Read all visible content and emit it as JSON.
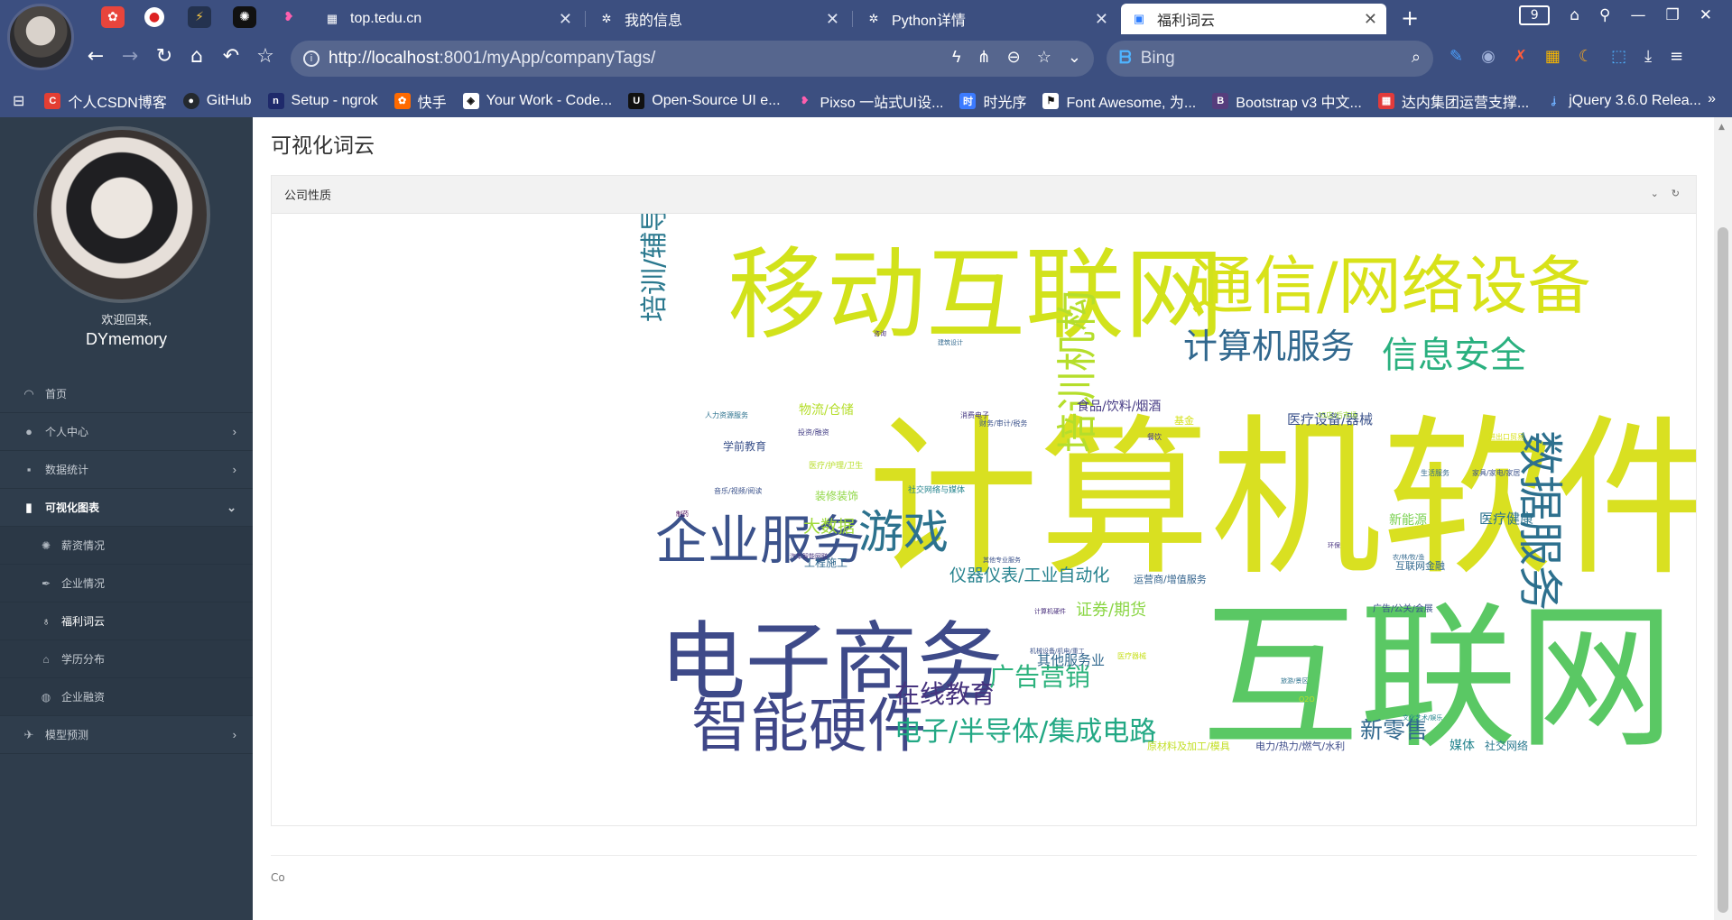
{
  "browser": {
    "tabs": [
      {
        "title": "top.tedu.cn"
      },
      {
        "title": "我的信息"
      },
      {
        "title": "Python详情"
      },
      {
        "title": "福利词云"
      }
    ],
    "tab_count": "9",
    "url_host": "http://localhost",
    "url_rest": ":8001/myApp/companyTags/",
    "search_placeholder": "Bing",
    "bookmarks": [
      {
        "label": "个人CSDN博客",
        "icon": "csdn-icon",
        "color": "#e33e33"
      },
      {
        "label": "GitHub",
        "icon": "github-icon",
        "color": "#24292e"
      },
      {
        "label": "Setup - ngrok",
        "icon": "ngrok-icon",
        "color": "#1f2a6b"
      },
      {
        "label": "快手",
        "icon": "kuaishou-icon",
        "color": "#ff6a00"
      },
      {
        "label": "Your Work - Code...",
        "icon": "codepen-icon",
        "color": "#111111"
      },
      {
        "label": "Open-Source UI e...",
        "icon": "ui-icon",
        "color": "#111111"
      },
      {
        "label": "Pixso 一站式UI设...",
        "icon": "pixso-icon",
        "color": "#ff4fa3"
      },
      {
        "label": "时光序",
        "icon": "shiguangxu-icon",
        "color": "#3c7bff"
      },
      {
        "label": "Font Awesome, 为...",
        "icon": "flag-icon",
        "color": "#111111"
      },
      {
        "label": "Bootstrap v3 中文...",
        "icon": "bootstrap-icon",
        "color": "#563d7c"
      },
      {
        "label": "达内集团运营支撑...",
        "icon": "tedu-icon",
        "color": "#e23b3b"
      },
      {
        "label": "jQuery 3.6.0 Relea...",
        "icon": "jquery-icon",
        "color": "#2f6ac0"
      }
    ]
  },
  "sidebar": {
    "welcome": "欢迎回来,",
    "username": "DYmemory",
    "menu": [
      {
        "label": "首页",
        "icon": "dashboard-icon"
      },
      {
        "label": "个人中心",
        "icon": "user-icon"
      },
      {
        "label": "数据统计",
        "icon": "grid-icon"
      },
      {
        "label": "可视化图表",
        "icon": "bar-chart-icon"
      },
      {
        "label": "模型预测",
        "icon": "plane-icon"
      }
    ],
    "submenu": [
      {
        "label": "薪资情况",
        "icon": "sun-icon"
      },
      {
        "label": "企业情况",
        "icon": "feather-icon"
      },
      {
        "label": "福利词云",
        "icon": "lightbulb-icon"
      },
      {
        "label": "学历分布",
        "icon": "graduation-cap-icon"
      },
      {
        "label": "企业融资",
        "icon": "globe-icon"
      }
    ]
  },
  "main": {
    "page_title": "可视化词云",
    "panel_title": "公司性质",
    "footer_text": "Co"
  },
  "wordcloud": {
    "words": [
      {
        "text": "计算机软件",
        "color": "#d9e021"
      },
      {
        "text": "互联网",
        "color": "#5ac864"
      },
      {
        "text": "移动互联网",
        "color": "#d2e21b"
      },
      {
        "text": "通信/网络设备",
        "color": "#d8e219"
      },
      {
        "text": "电子商务",
        "color": "#3e4a89"
      },
      {
        "text": "企业服务",
        "color": "#3b528b"
      },
      {
        "text": "智能硬件",
        "color": "#3f4788"
      },
      {
        "text": "游戏",
        "color": "#2c728e"
      },
      {
        "text": "计算机服务",
        "color": "#31688e"
      },
      {
        "text": "信息安全",
        "color": "#2ab07f"
      },
      {
        "text": "数据服务",
        "color": "#2d708e"
      },
      {
        "text": "培训机构",
        "color": "#b5de2b"
      },
      {
        "text": "培训/辅导机构",
        "color": "#2a788e"
      },
      {
        "text": "在线教育",
        "color": "#46337e"
      },
      {
        "text": "广告营销",
        "color": "#2db27d"
      },
      {
        "text": "电子/半导体/集成电路",
        "color": "#22a884"
      },
      {
        "text": "新零售",
        "color": "#31688e"
      },
      {
        "text": "仪器仪表/工业自动化",
        "color": "#26828e"
      },
      {
        "text": "大数据",
        "color": "#a0da39"
      },
      {
        "text": "证券/期货",
        "color": "#8bd646"
      },
      {
        "text": "医疗设备/器械",
        "color": "#3b528b"
      },
      {
        "text": "医疗健康",
        "color": "#2c728e"
      },
      {
        "text": "新能源",
        "color": "#7ad151"
      },
      {
        "text": "其他服务业",
        "color": "#31688e"
      },
      {
        "text": "物流/仓储",
        "color": "#b5de2b"
      },
      {
        "text": "食品/饮料/烟酒",
        "color": "#443983"
      },
      {
        "text": "学前教育",
        "color": "#3b528b"
      },
      {
        "text": "工程施工",
        "color": "#31688e"
      },
      {
        "text": "运营商/增值服务",
        "color": "#33638d"
      },
      {
        "text": "装修装饰",
        "color": "#8fd744"
      },
      {
        "text": "互联网金融",
        "color": "#31688e"
      },
      {
        "text": "广告/公关/会展",
        "color": "#3b528b"
      },
      {
        "text": "媒体",
        "color": "#25858e"
      },
      {
        "text": "社交网络",
        "color": "#2a788e"
      },
      {
        "text": "电力/热力/燃气/水利",
        "color": "#3e4c8a"
      },
      {
        "text": "原材料及加工/模具",
        "color": "#c2df23"
      },
      {
        "text": "基金",
        "color": "#d5e21a"
      },
      {
        "text": "医疗/护理/卫生",
        "color": "#b8de29"
      },
      {
        "text": "社交网络与媒体",
        "color": "#25848e"
      },
      {
        "text": "音乐/视频/阅读",
        "color": "#3b528b"
      },
      {
        "text": "人力资源服务",
        "color": "#2c728e"
      },
      {
        "text": "投资/融资",
        "color": "#433e85"
      },
      {
        "text": "财务/审计/税务",
        "color": "#3b528b"
      },
      {
        "text": "消费电子",
        "color": "#453882"
      },
      {
        "text": "餐饮",
        "color": "#443983"
      },
      {
        "text": "家具/家电/家居",
        "color": "#3b528b"
      },
      {
        "text": "生活服务",
        "color": "#31688e"
      },
      {
        "text": "4S店/后市场",
        "color": "#9fda3a"
      },
      {
        "text": "进出口贸易",
        "color": "#d8e219"
      },
      {
        "text": "农/林/牧/渔",
        "color": "#31688e"
      },
      {
        "text": "汽车智能网联",
        "color": "#46327e"
      },
      {
        "text": "其他专业服务",
        "color": "#3b528b"
      },
      {
        "text": "计算机硬件",
        "color": "#472d7b"
      },
      {
        "text": "机械设备/机电/重工",
        "color": "#3b528b"
      },
      {
        "text": "医疗器械",
        "color": "#c8e020"
      },
      {
        "text": "旅游/景区",
        "color": "#2c728e"
      },
      {
        "text": "文化艺术/娱乐",
        "color": "#25858e"
      },
      {
        "text": "咨询",
        "color": "#472c7a"
      },
      {
        "text": "建筑设计",
        "color": "#31688e"
      },
      {
        "text": "制药",
        "color": "#440154"
      },
      {
        "text": "环保",
        "color": "#46307e"
      },
      {
        "text": "O2O",
        "color": "#bddf26"
      },
      {
        "text": "游戏",
        "color": "#31688e"
      }
    ]
  }
}
